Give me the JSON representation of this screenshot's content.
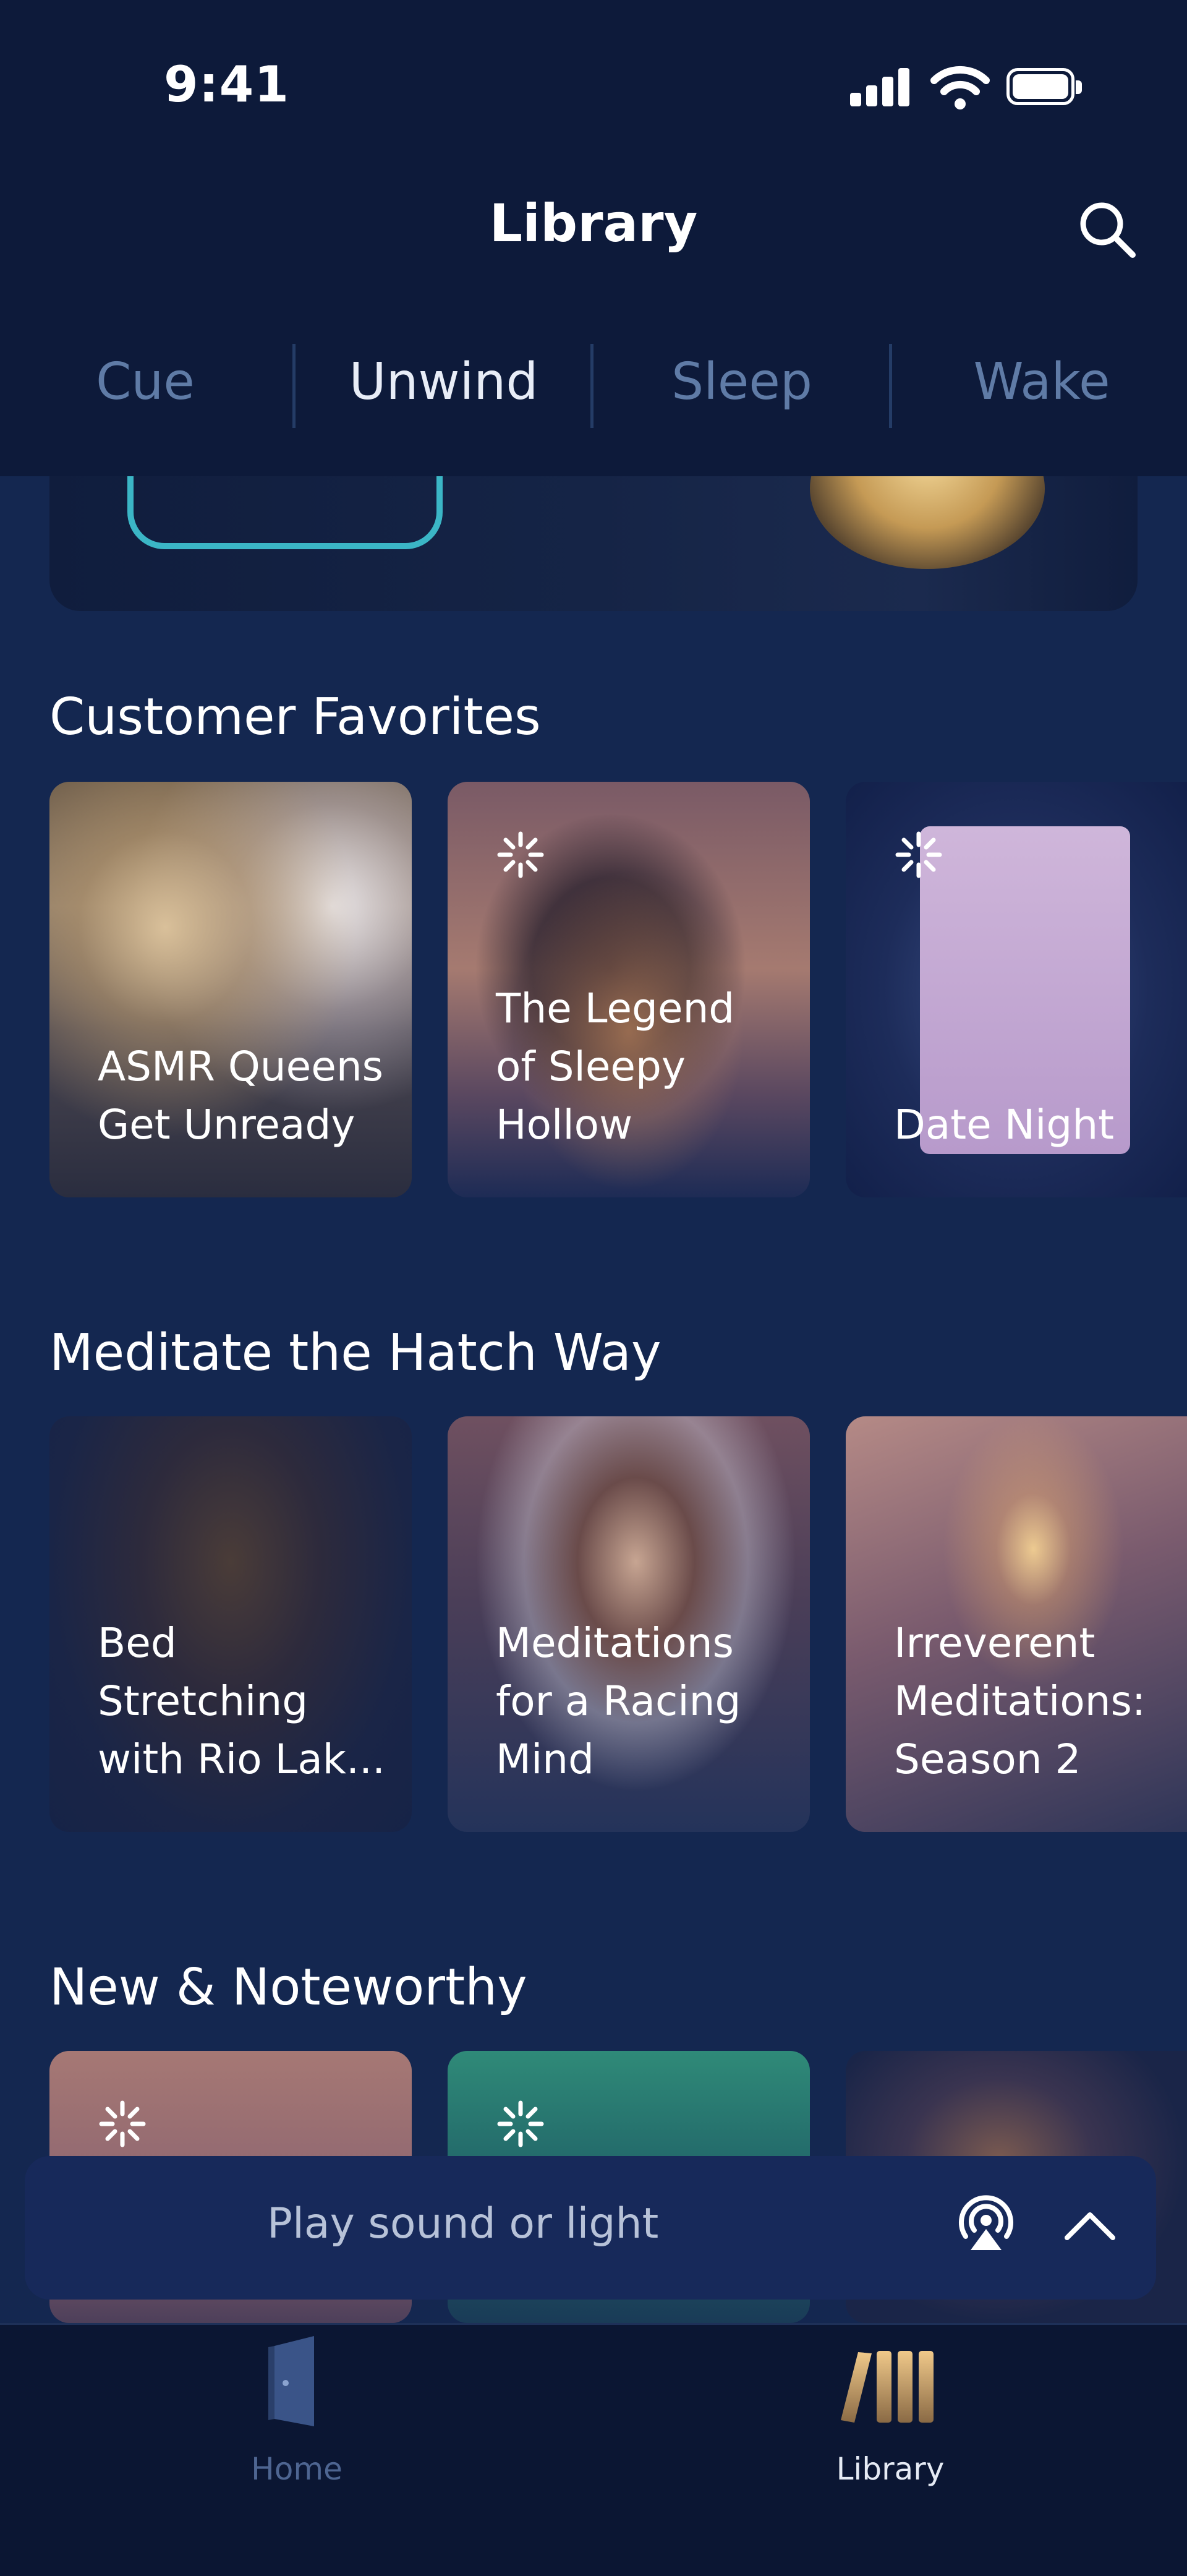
{
  "status_bar": {
    "time": "9:41"
  },
  "header": {
    "title": "Library"
  },
  "tabs": [
    {
      "label": "Cue",
      "active": false
    },
    {
      "label": "Unwind",
      "active": true
    },
    {
      "label": "Sleep",
      "active": false
    },
    {
      "label": "Wake",
      "active": false
    }
  ],
  "sections": [
    {
      "title": "Customer Favorites",
      "cards": [
        {
          "title": "ASMR Queens Get Unready"
        },
        {
          "title": "The Legend of Sleepy Hollow"
        },
        {
          "title": "Date Night"
        }
      ]
    },
    {
      "title": "Meditate the Hatch Way",
      "cards": [
        {
          "title": "Bed Stretching with Rio Lak..."
        },
        {
          "title": "Meditations for a Racing Mind"
        },
        {
          "title": "Irreverent Meditations: Season 2"
        }
      ]
    },
    {
      "title": "New & Noteworthy",
      "cards": [
        {},
        {},
        {}
      ]
    }
  ],
  "player": {
    "placeholder": "Play sound or light"
  },
  "bottom_nav": [
    {
      "label": "Home",
      "active": false
    },
    {
      "label": "Library",
      "active": true
    }
  ],
  "colors": {
    "background": "#142750",
    "header": "#0d1a3a",
    "accent_teal": "#3bb6c6",
    "tab_inactive": "#5f7ba6"
  }
}
